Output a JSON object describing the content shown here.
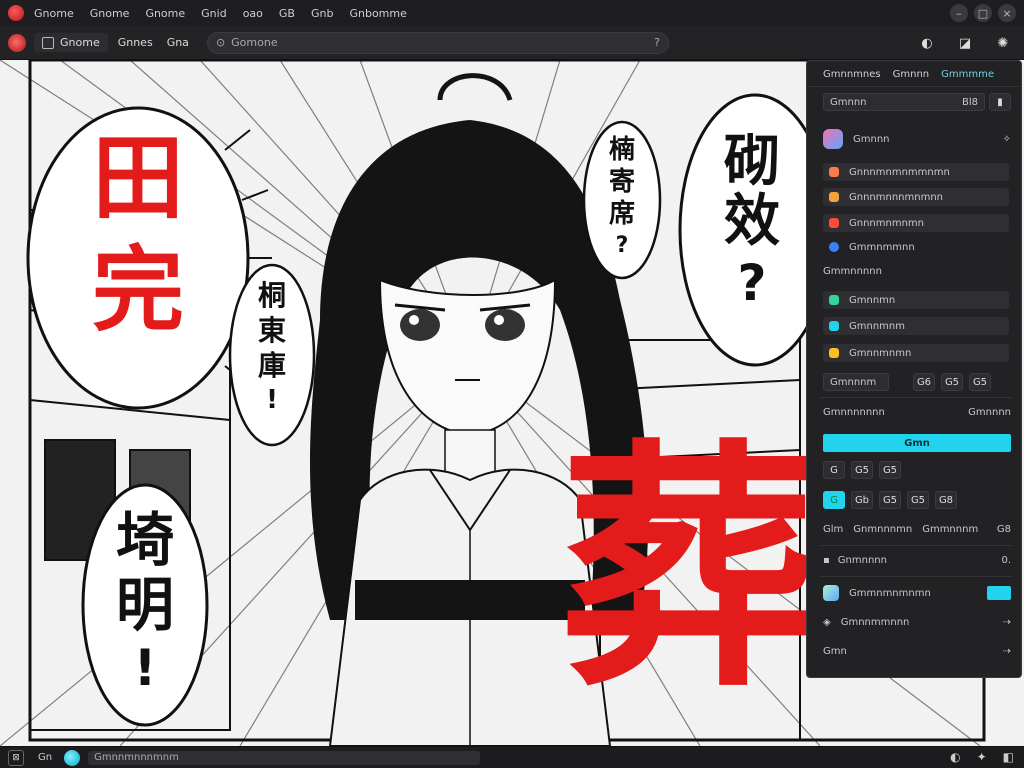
{
  "menubar": {
    "items": [
      "Gnome",
      "Gnome",
      "Gnome",
      "Gnid",
      "oao",
      "GB",
      "Gnb",
      "Gnbomme"
    ],
    "controls": [
      "–",
      "□",
      "×"
    ]
  },
  "toolbar": {
    "tab_label": "Gnome",
    "text1": "Gnnes",
    "text2": "Gna",
    "search_value": "Gomone",
    "search_help": "?",
    "right_icons": [
      "◐",
      "◪",
      "✺"
    ]
  },
  "canvas": {
    "bubble_left_top": [
      "田",
      "完"
    ],
    "bubble_left_mid": [
      "桐",
      "東",
      "庫",
      "!"
    ],
    "bubble_left_bottom": [
      "埼",
      "明",
      "!"
    ],
    "bubble_center_top": [
      "楠",
      "寄",
      "席",
      "?"
    ],
    "bubble_right_top": [
      "砌",
      "效",
      "?"
    ],
    "big_red_char": "葬"
  },
  "panel": {
    "tabs": [
      "Gmnnmnes",
      "Gmnnn",
      "Gmmmme"
    ],
    "search_value": "Gmnnn",
    "search_suffix": "Bl8",
    "layer_header": "Gmnnn",
    "layers_a": [
      {
        "label": "Gnnnmnmnmmnmn",
        "color": "#ff7a4a"
      },
      {
        "label": "Gnnnmnnnmnmnn",
        "color": "#f3a33a"
      },
      {
        "label": "Gnnnmnmnmn",
        "color": "#ff4b3a"
      },
      {
        "label": "Gmmnmmnn",
        "color": "#3b82f6"
      }
    ],
    "section_b": "Gmmnnnnn",
    "layers_b": [
      {
        "label": "Gmnnmn",
        "color": "#34d399"
      },
      {
        "label": "Gmnnmnm",
        "color": "#22d3ee"
      },
      {
        "label": "Gmnnmnmn",
        "color": "#fbbf24"
      }
    ],
    "row_c_label": "Gmnnnm",
    "row_c_btns": [
      "G6",
      "G5",
      "G5"
    ],
    "row_d_label": "Gmnnnnnnn",
    "row_d_value": "Gmnnnn",
    "cyan_bar_label": "Gmn",
    "icon_row_1": [
      "G",
      "G5",
      "G5"
    ],
    "icon_row_2": [
      "G",
      "Gb",
      "G5",
      "G5",
      "G8"
    ],
    "row_e": [
      "Glm",
      "Gnmnnnmn",
      "Gmmnnnm",
      "G8"
    ],
    "row_f_label": "Gnmnnnn",
    "row_f_value": "0.",
    "row_g_label": "Gmmnmnmnmn",
    "row_h_label": "Gmnnmmnnn",
    "row_i_label": "Gmn"
  },
  "statusbar": {
    "btn": "⊠",
    "text1": "Gn",
    "field": "Gmnnmnnnmnm",
    "right_icons": [
      "◐",
      "✦",
      "◧"
    ]
  }
}
